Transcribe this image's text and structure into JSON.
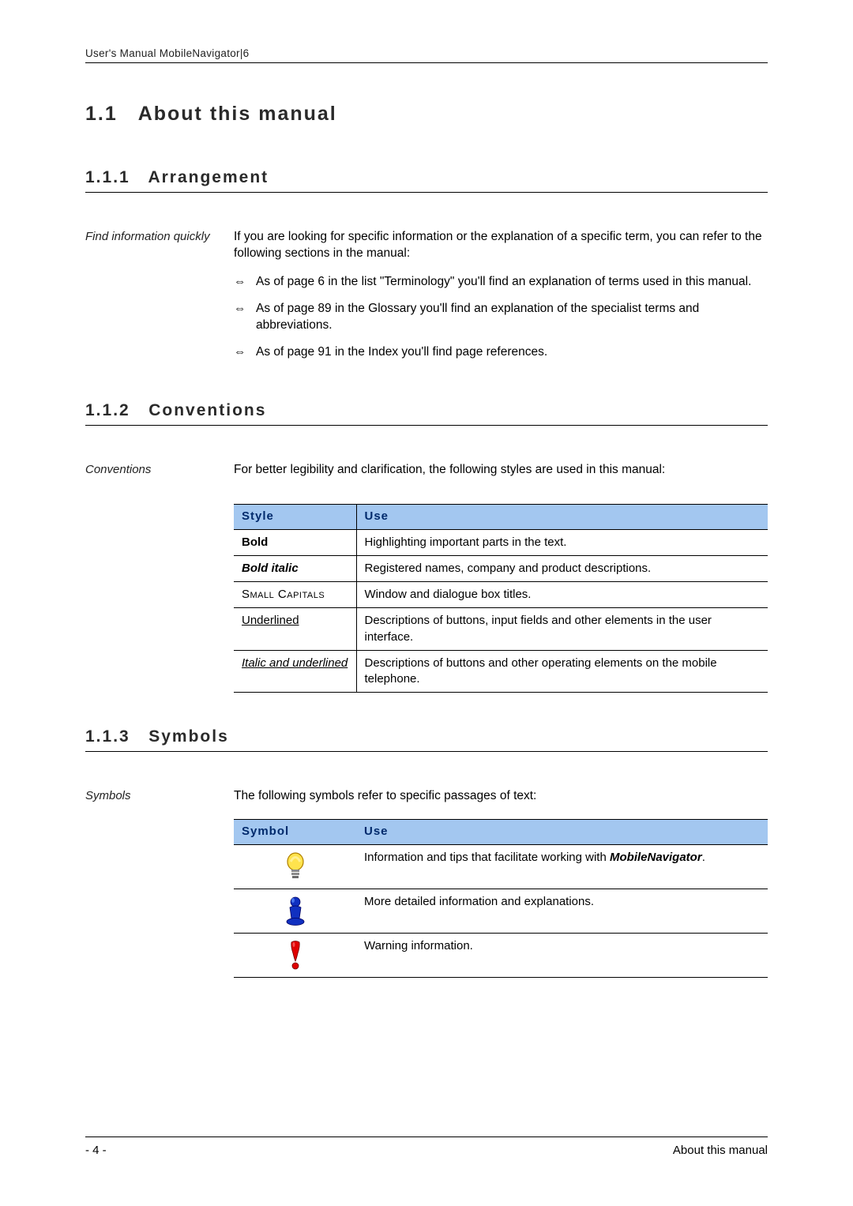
{
  "header": "User's Manual MobileNavigator|6",
  "section": {
    "num": "1.1",
    "title": "About this manual"
  },
  "sub1": {
    "num": "1.1.1",
    "title": "Arrangement",
    "sideLabel": "Find information quickly",
    "intro": "If you are looking for specific information or the explanation of a specific term, you can refer to the following sections in the manual:",
    "bulletGlyph": "⇔",
    "items": [
      "As of page 6 in the list \"Terminology\" you'll find an explanation of terms used in this manual.",
      "As of page 89 in the Glossary you'll find an explanation of the specialist terms and abbreviations.",
      "As of page 91 in the Index you'll find page references."
    ]
  },
  "sub2": {
    "num": "1.1.2",
    "title": "Conventions",
    "sideLabel": "Conventions",
    "intro": "For better legibility and clarification, the following styles are used in this manual:",
    "table": {
      "headers": [
        "Style",
        "Use"
      ],
      "rows": [
        {
          "style": "Bold",
          "styleClass": "bold",
          "use": "Highlighting important parts in the text."
        },
        {
          "style": "Bold italic",
          "styleClass": "bolditalic",
          "use": "Registered names, company and product descriptions."
        },
        {
          "style": "Small Capitals",
          "styleClass": "small-caps",
          "use": "Window and dialogue box titles."
        },
        {
          "style": "Underlined",
          "styleClass": "underline",
          "use": "Descriptions of buttons, input fields and other elements in the user interface."
        },
        {
          "style": "Italic and underlined",
          "styleClass": "italunder",
          "use": "Descriptions of buttons and other operating elements on the mobile telephone."
        }
      ]
    }
  },
  "sub3": {
    "num": "1.1.3",
    "title": "Symbols",
    "sideLabel": "Symbols",
    "intro": "The following symbols refer to specific passages of text:",
    "table": {
      "headers": [
        "Symbol",
        "Use"
      ],
      "rows": [
        {
          "icon": "lightbulb",
          "usePrefix": "Information and tips that facilitate working with ",
          "useEm": "MobileNavigator",
          "useSuffix": "."
        },
        {
          "icon": "pawn",
          "usePrefix": "More detailed information and explanations.",
          "useEm": "",
          "useSuffix": ""
        },
        {
          "icon": "exclaim",
          "usePrefix": "Warning information.",
          "useEm": "",
          "useSuffix": ""
        }
      ]
    }
  },
  "footer": {
    "left": "- 4 -",
    "right": "About this manual"
  }
}
